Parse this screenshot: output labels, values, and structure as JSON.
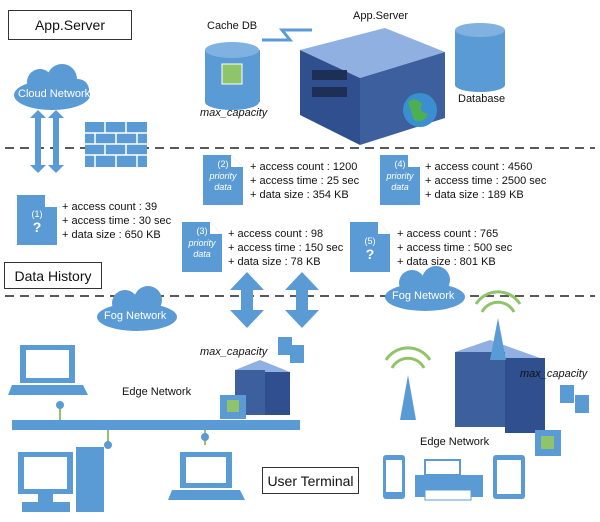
{
  "labels": {
    "app_server_box": "App.Server",
    "data_history": "Data History",
    "user_terminal": "User Terminal"
  },
  "top": {
    "cache_db": "Cache DB",
    "app_server": "App.Server",
    "database": "Database",
    "max_capacity": "max_capacity",
    "cloud": "Cloud Network"
  },
  "docs": [
    {
      "num": "(1)",
      "tag": "?",
      "attrs": [
        "+ access count : 39",
        "+ access time : 30 sec",
        "+ data size : 650 KB"
      ]
    },
    {
      "num": "(2)",
      "tag": "priority data",
      "attrs": [
        "+ access count : 1200",
        "+ access time : 25 sec",
        "+ data size : 354 KB"
      ]
    },
    {
      "num": "(3)",
      "tag": "priority data",
      "attrs": [
        "+ access count : 98",
        "+ access time : 150 sec",
        "+ data size : 78 KB"
      ]
    },
    {
      "num": "(4)",
      "tag": "priority data",
      "attrs": [
        "+ access count : 4560",
        "+ access time : 2500 sec",
        "+ data size : 189 KB"
      ]
    },
    {
      "num": "(5)",
      "tag": "?",
      "attrs": [
        "+ access count : 765",
        "+ access time : 500 sec",
        "+ data size : 801 KB"
      ]
    }
  ],
  "bottom": {
    "fog_left": "Fog Network",
    "fog_right": "Fog Network",
    "edge_left": "Edge Network",
    "edge_right": "Edge Network",
    "max_capacity_left": "max_capacity",
    "max_capacity_right": "max_capacity"
  },
  "colors": {
    "accent": "#5b9bd5",
    "server": "#3e5f9e"
  }
}
